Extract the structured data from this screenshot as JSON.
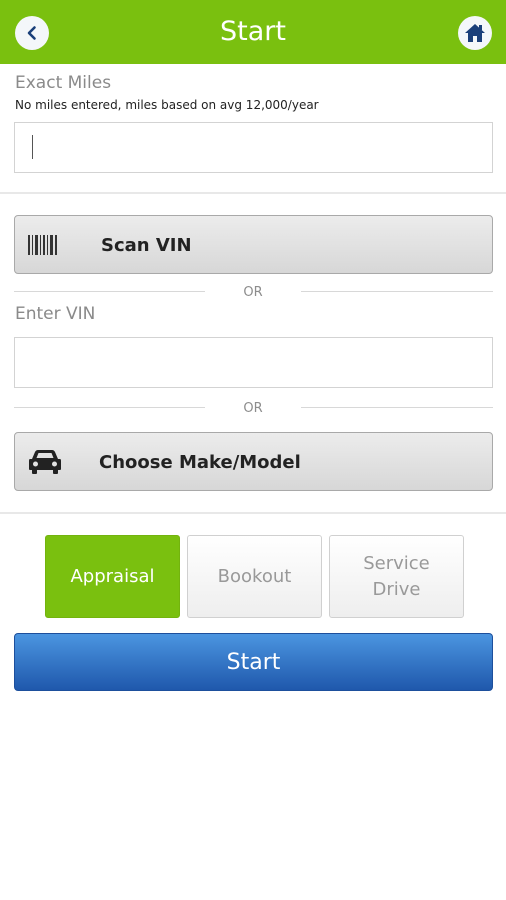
{
  "header": {
    "title": "Start",
    "back_icon": "chevron-left-icon",
    "home_icon": "home-icon",
    "bar_color": "#7ac00f"
  },
  "miles": {
    "label": "Exact Miles",
    "hint": "No miles entered, miles based on avg 12,000/year",
    "value": ""
  },
  "scan_vin": {
    "label": "Scan VIN",
    "icon": "barcode-icon"
  },
  "or_text": "OR",
  "vin": {
    "label": "Enter VIN",
    "value": ""
  },
  "make_model": {
    "label": "Choose Make/Model",
    "icon": "car-icon"
  },
  "modes": [
    {
      "label": "Appraisal",
      "active": true
    },
    {
      "label": "Bookout",
      "active": false
    },
    {
      "label": "Service Drive",
      "active": false
    }
  ],
  "start_button": {
    "label": "Start",
    "color": "#2a6bc4"
  }
}
